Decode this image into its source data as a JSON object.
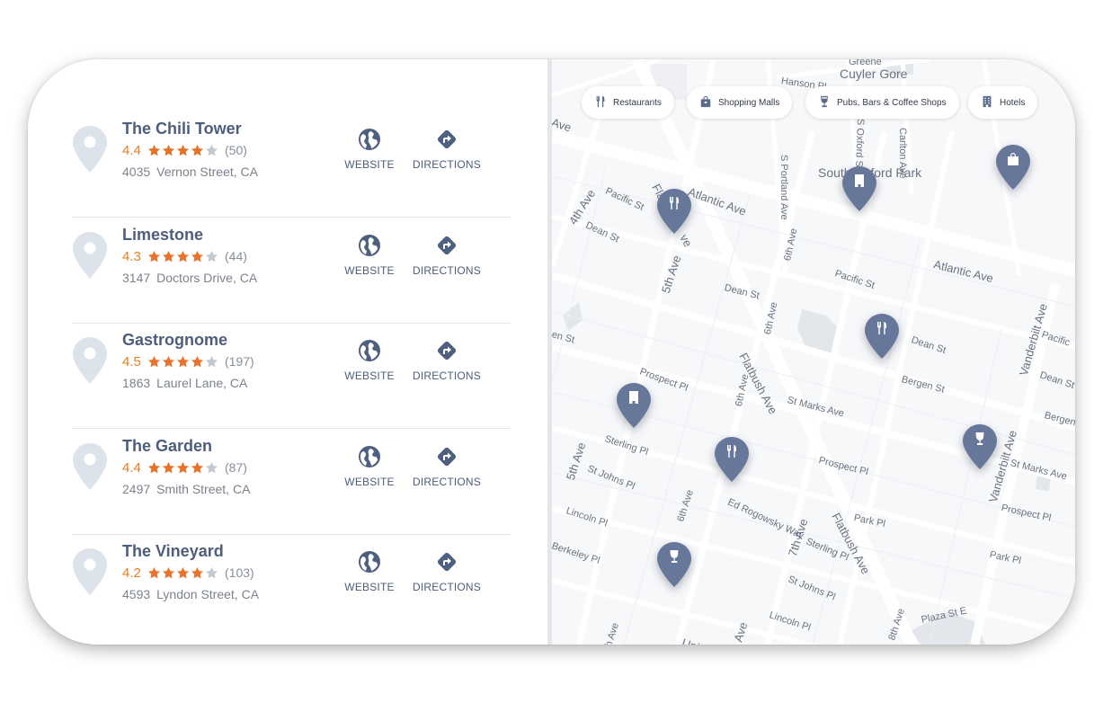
{
  "places": [
    {
      "name": "The Chili Tower",
      "rating": "4.4",
      "reviews": "(50)",
      "number": "4035",
      "street": "Vernon Street, CA",
      "stars": 4
    },
    {
      "name": "Limestone",
      "rating": "4.3",
      "reviews": "(44)",
      "number": "3147",
      "street": "Doctors Drive, CA",
      "stars": 4
    },
    {
      "name": "Gastrognome",
      "rating": "4.5",
      "reviews": "(197)",
      "number": "1863",
      "street": "Laurel Lane, CA",
      "stars": 4
    },
    {
      "name": "The Garden",
      "rating": "4.4",
      "reviews": "(87)",
      "number": "2497",
      "street": "Smith Street, CA",
      "stars": 4
    },
    {
      "name": "The Vineyard",
      "rating": "4.2",
      "reviews": "(103)",
      "number": "4593",
      "street": "Lyndon Street, CA",
      "stars": 4
    }
  ],
  "actions": {
    "website": "WEBSITE",
    "directions": "DIRECTIONS"
  },
  "filters": [
    {
      "label": "Restaurants",
      "icon": "fork-knife-icon"
    },
    {
      "label": "Shopping Malls",
      "icon": "shopping-bag-icon"
    },
    {
      "label": "Pubs, Bars & Coffee Shops",
      "icon": "wine-glass-icon"
    },
    {
      "label": "Hotels",
      "icon": "hotel-icon"
    }
  ],
  "map_labels": {
    "cuyler_gore": "Cuyler Gore",
    "south_oxford": "South Oxford Park",
    "atlantic_ave": "Atlantic Ave",
    "atlantic_ave_2": "Atlantic Ave",
    "ave_top": "Ave",
    "pacific_st": "Pacific St",
    "pacific_st_2": "Pacific St",
    "pacific_right": "Pacific",
    "dean_st": "Dean St",
    "dean_st_2": "Dean St",
    "dean_st_3": "Dean St",
    "dean_st_4": "Dean St",
    "fourth_ave": "4th Ave",
    "fifth_ave": "5th Ave",
    "fifth_ave_2": "5th Ave",
    "sixth_ave": "6th Ave",
    "sixth_ave_2": "6th Ave",
    "sixth_ave_3": "6th Ave",
    "sixth_ave_4": "6th Ave",
    "sixth_ave_5": "6th Ave",
    "seventh_ave": "7th Ave",
    "seventh_ave_2": "7th Ave",
    "eighth_ave": "8th Ave",
    "flatbush_ave": "Flatbush Ave",
    "flatbush_ave_2": "Flatbush Ave",
    "flatbush_top": "Fla",
    "flatbush_top_2": "ve",
    "s_portland": "S Portland Ave",
    "s_oxford": "S Oxford St",
    "carlton_ave": "Carlton Ave",
    "vanderbilt_ave": "Vanderbilt Ave",
    "vanderbilt_ave_2": "Vanderbilt Ave",
    "prospect_pl": "Prospect Pl",
    "prospect_pl_2": "Prospect Pl",
    "prospect_pl_3": "Prospect Pl",
    "bergen_st": "Bergen St",
    "bergen_st_2": "Bergen St",
    "st_marks": "St Marks Ave",
    "st_marks_2": "St Marks Ave",
    "sterling_pl": "Sterling Pl",
    "sterling_pl_2": "Sterling Pl",
    "st_johns": "St Johns Pl",
    "st_johns_2": "St Johns Pl",
    "lincoln_pl": "Lincoln Pl",
    "lincoln_pl_2": "Lincoln Pl",
    "berkeley_pl": "Berkeley Pl",
    "ed_rogowsky": "Ed Rogowsky Way",
    "park_pl": "Park Pl",
    "park_pl_2": "Park Pl",
    "plaza_st": "Plaza St E",
    "hanson_pl": "Hanson Pl",
    "union": "Union",
    "en_st": "en St",
    "greene": "Greene"
  },
  "colors": {
    "pin": "#66779a",
    "accent": "#e67e22",
    "text": "#4d5d7c",
    "place_pin": "#dde3ea"
  }
}
